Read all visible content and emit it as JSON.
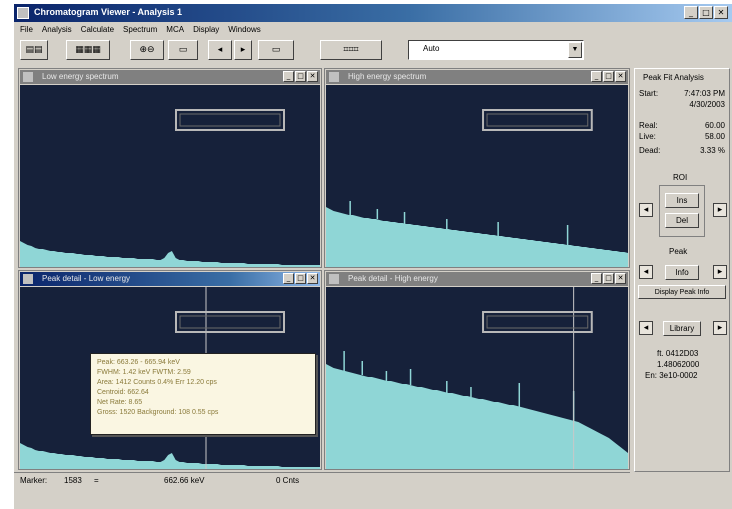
{
  "window": {
    "title": "Chromatogram Viewer - Analysis 1"
  },
  "menubar": [
    "File",
    "Analysis",
    "Calculate",
    "Spectrum",
    "MCA",
    "Display",
    "Windows"
  ],
  "toolbar": {
    "combo_value": "Auto"
  },
  "panes": [
    {
      "title": "Low energy spectrum"
    },
    {
      "title": "High energy spectrum"
    },
    {
      "title": "Peak detail - Low energy"
    },
    {
      "title": "Peak detail - High energy"
    }
  ],
  "tooltip": {
    "lines": [
      "Peak: 663.26 - 665.94 keV",
      "FWHM: 1.42 keV  FWTM: 2.59",
      "Area: 1412 Counts 0.4% Err  12.20 cps",
      "Centroid: 662.64",
      "Net Rate: 8.65",
      "Gross: 1520  Background: 108  0.55 cps"
    ]
  },
  "statusbar": {
    "channel_label": "Marker:",
    "channel_value": "1583",
    "energy_value": "662.66 keV",
    "counts_value": "0 Cnts"
  },
  "sidepanel": {
    "heading": "Peak Fit Analysis",
    "start_label": "Start:",
    "start_value": "7:47:03 PM",
    "start_date": "4/30/2003",
    "real_label": "Real:",
    "real_value": "60.00",
    "live_label": "Live:",
    "live_value": "58.00",
    "dead_label": "Dead:",
    "dead_value": "3.33 %",
    "roi_label": "ROI",
    "roi_btn1": "Ins",
    "roi_btn2": "Del",
    "peak_label": "Peak",
    "peak_btn": "Info",
    "peak_check": "Display Peak Info",
    "library_btn": "Library",
    "footer_line1": "ft. 0412D03",
    "footer_line2": "1.48062000",
    "footer_line3": "En: 3e10-0002"
  },
  "colors": {
    "plot_bg": "#16213a",
    "spectrum_fill": "#8fd6d6",
    "marker_box": "#b8b8b8",
    "title_active": "#0a246a"
  },
  "spectra": {
    "low_a": [
      26,
      24,
      22,
      21,
      19,
      18,
      18,
      17,
      16,
      16,
      15,
      15,
      14,
      14,
      14,
      13,
      13,
      12,
      12,
      12,
      11,
      11,
      11,
      10,
      10,
      10,
      10,
      9,
      9,
      9,
      9,
      8,
      8,
      8,
      8,
      8,
      7,
      7,
      9,
      14,
      16,
      9,
      7,
      7,
      6,
      6,
      6,
      6,
      5,
      5,
      5,
      5,
      5,
      4,
      4,
      4,
      4,
      4,
      4,
      4,
      3,
      3,
      3,
      3,
      3,
      3,
      3,
      3,
      3,
      2,
      2,
      2,
      2,
      2,
      2,
      2,
      2,
      2,
      2,
      2
    ],
    "high_a": [
      60,
      58,
      56,
      55,
      54,
      53,
      52,
      52,
      51,
      50,
      49,
      49,
      48,
      48,
      47,
      46,
      46,
      45,
      45,
      44,
      44,
      43,
      43,
      42,
      42,
      41,
      41,
      40,
      40,
      39,
      39,
      38,
      38,
      37,
      37,
      36,
      36,
      35,
      35,
      34,
      34,
      33,
      33,
      32,
      32,
      31,
      31,
      30,
      30,
      29,
      29,
      28,
      28,
      27,
      27,
      26,
      26,
      25,
      25,
      24,
      24,
      23,
      23,
      22,
      22,
      21,
      21,
      20,
      20,
      19,
      19,
      18,
      18,
      17,
      17,
      16,
      16,
      15,
      15,
      14
    ],
    "high_b": [
      105,
      103,
      101,
      100,
      99,
      98,
      97,
      96,
      95,
      94,
      93,
      92,
      92,
      91,
      90,
      89,
      88,
      88,
      87,
      86,
      85,
      85,
      84,
      83,
      82,
      82,
      81,
      80,
      79,
      79,
      78,
      77,
      76,
      76,
      75,
      74,
      73,
      73,
      72,
      71,
      70,
      70,
      69,
      68,
      67,
      67,
      66,
      65,
      64,
      64,
      63,
      62,
      61,
      60,
      59,
      58,
      57,
      56,
      55,
      54,
      53,
      52,
      51,
      50,
      49,
      48,
      47,
      45,
      43,
      41,
      39,
      37,
      35,
      33,
      31,
      28,
      25,
      22,
      19,
      16
    ]
  }
}
